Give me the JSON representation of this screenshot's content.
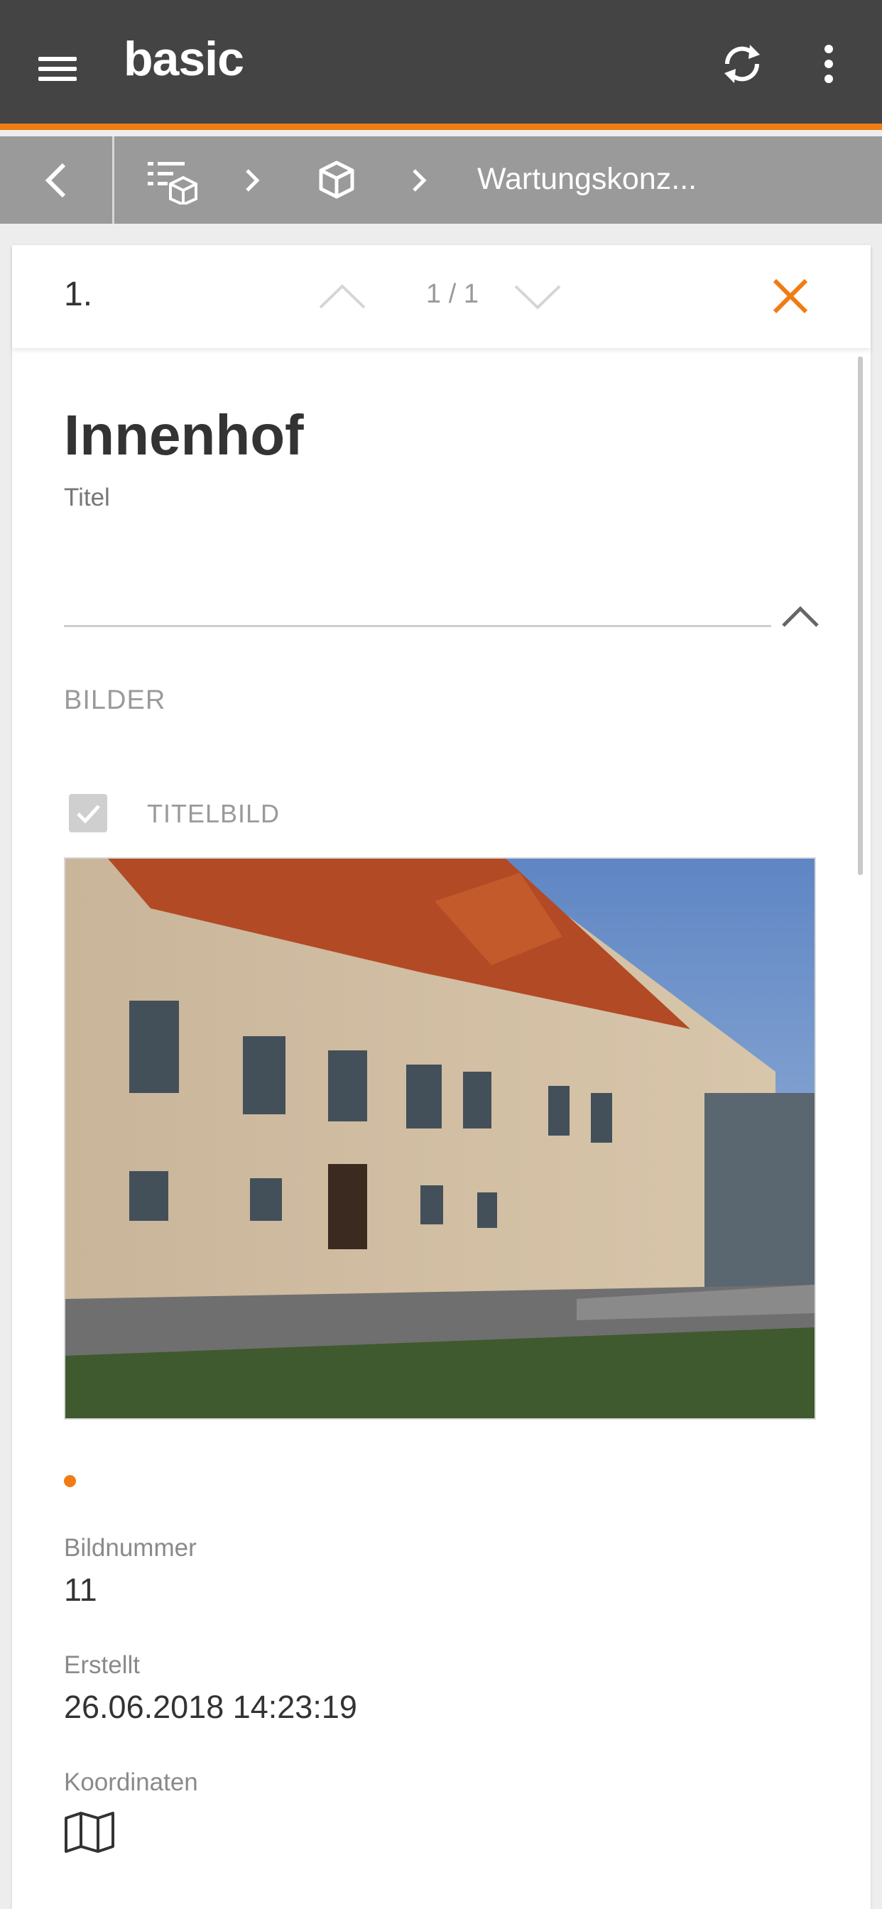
{
  "app": {
    "title": "basic"
  },
  "breadcrumb": {
    "current": "Wartungskonz..."
  },
  "card": {
    "index": "1.",
    "pager": "1 / 1",
    "title": "Innenhof",
    "title_label": "Titel",
    "section_heading": "BILDER",
    "cover_label": "TITELBILD",
    "cover_checked": true,
    "carousel_active": 1,
    "carousel_total": 1,
    "fields": [
      {
        "label": "Bildnummer",
        "value": "11"
      },
      {
        "label": "Erstellt",
        "value": "26.06.2018 14:23:19"
      },
      {
        "label": "Koordinaten"
      }
    ]
  },
  "colors": {
    "appbar": "#444444",
    "accent": "#f07c12",
    "breadcrumb_bar": "#9a9a9a"
  },
  "icons": [
    "menu-icon",
    "sync-icon",
    "more-vert-icon",
    "chevron-left-icon",
    "list-cube-icon",
    "chevron-right-icon",
    "cube-icon",
    "chevron-up-icon",
    "chevron-down-icon",
    "close-icon",
    "check-icon",
    "map-icon"
  ]
}
